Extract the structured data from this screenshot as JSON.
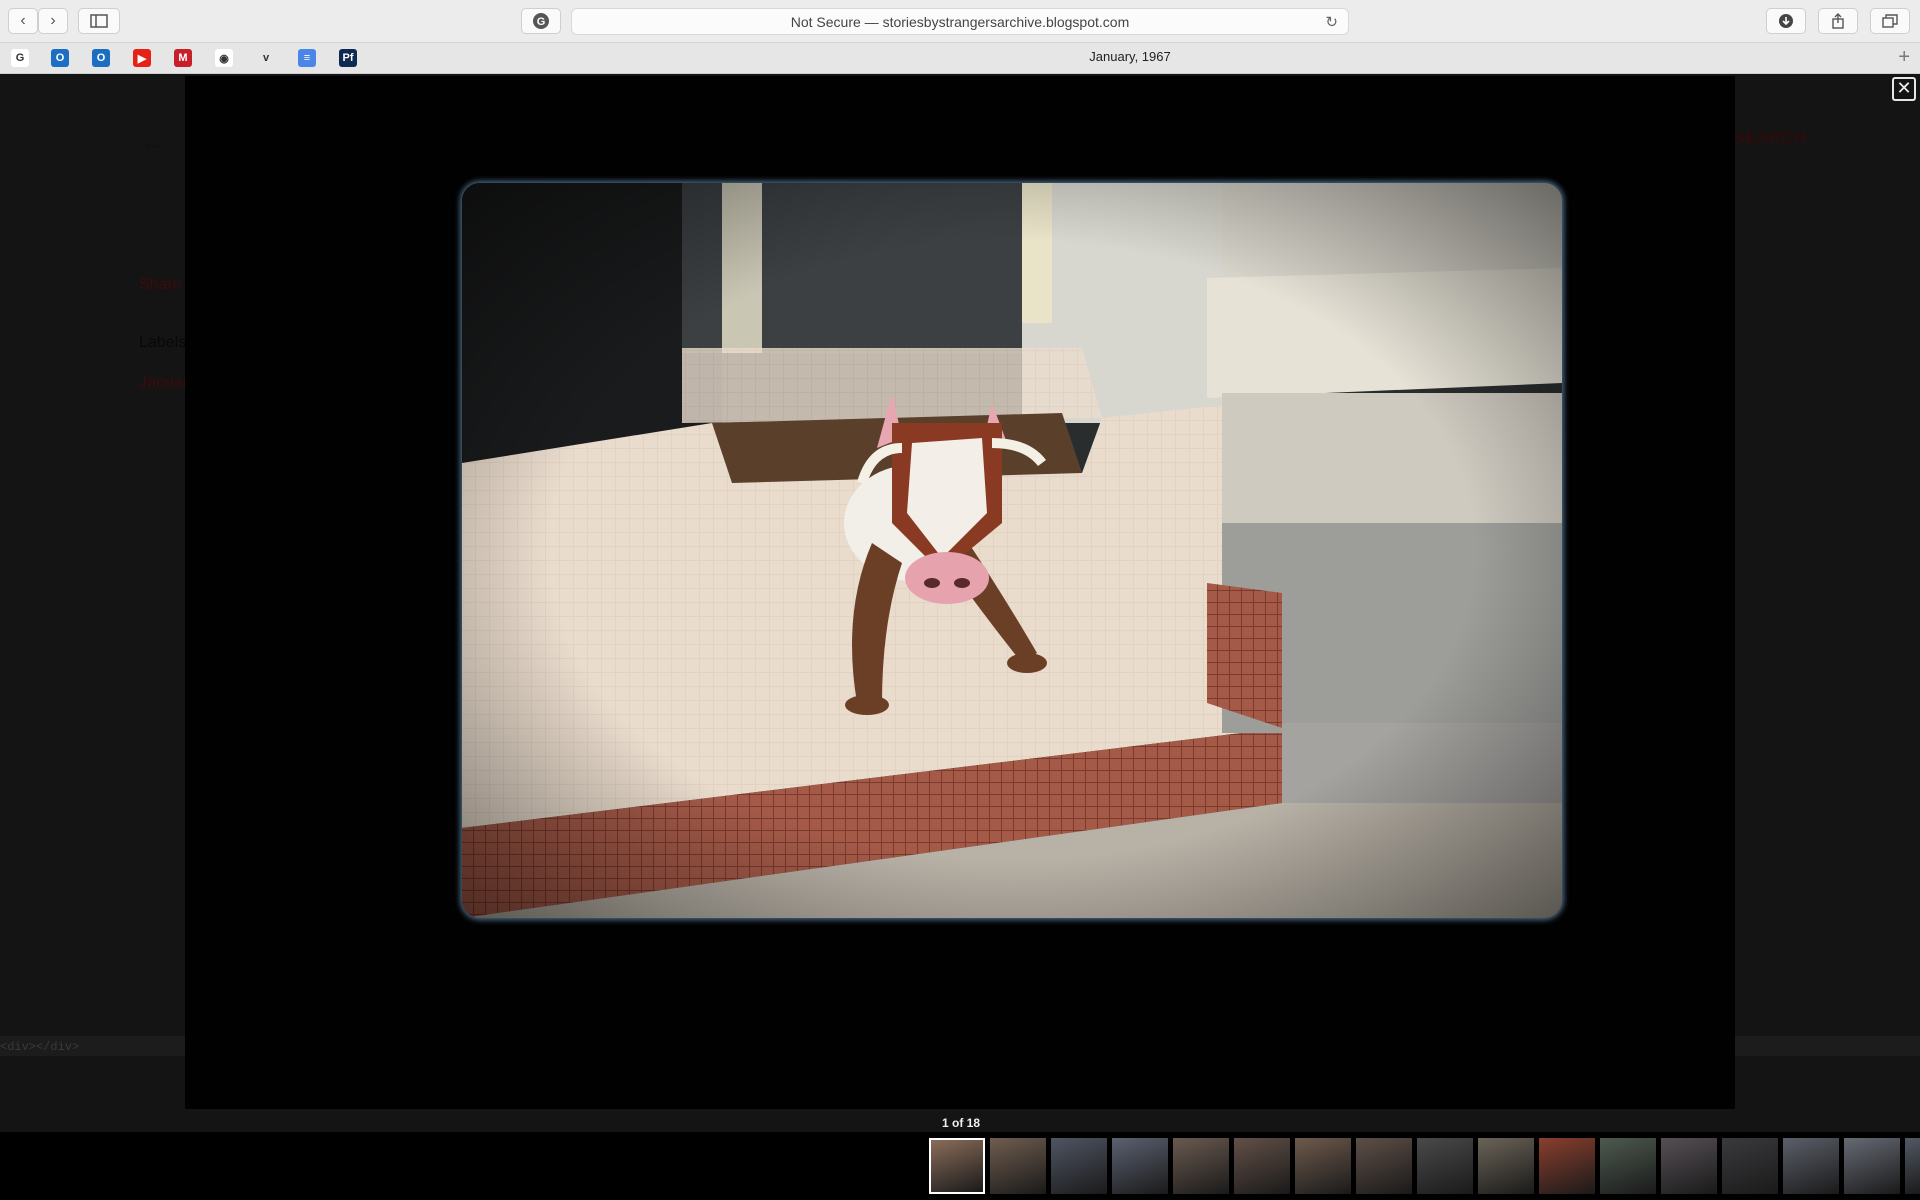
{
  "browser": {
    "address_text": "Not Secure — storiesbystrangersarchive.blogspot.com",
    "tab_title": "January, 1967",
    "bookmarks": [
      {
        "icon": "google-icon",
        "letter": "G",
        "color": "#ffffff"
      },
      {
        "icon": "outlook-icon",
        "letter": "O",
        "color": "#1b6ec2"
      },
      {
        "icon": "outlook-icon",
        "letter": "O",
        "color": "#1b6ec2"
      },
      {
        "icon": "youtube-icon",
        "letter": "▶",
        "color": "#e62117"
      },
      {
        "icon": "gmail-icon",
        "letter": "M",
        "color": "#c7202b"
      },
      {
        "icon": "eye-icon",
        "letter": "◉",
        "color": "#ffffff"
      },
      {
        "icon": "vimeo-icon",
        "letter": "v",
        "color": "#e6e6e6"
      },
      {
        "icon": "docs-icon",
        "letter": "≡",
        "color": "#4a86e8"
      },
      {
        "icon": "portfolio-icon",
        "letter": "Pf",
        "color": "#0f2a52"
      }
    ]
  },
  "page": {
    "search_label": "SEARCH",
    "share_label": "Share",
    "labels_heading": "Labels",
    "label_january": "January",
    "code_text": "<div></div>"
  },
  "lightbox": {
    "counter": "1 of 18",
    "thumbnails": [
      {
        "color": "#8a6d5a",
        "active": true
      },
      {
        "color": "#6f5d4f",
        "active": false
      },
      {
        "color": "#4f5563",
        "active": false
      },
      {
        "color": "#5b6170",
        "active": false
      },
      {
        "color": "#6a5a50",
        "active": false
      },
      {
        "color": "#625047",
        "active": false
      },
      {
        "color": "#6e5a4c",
        "active": false
      },
      {
        "color": "#5e4f47",
        "active": false
      },
      {
        "color": "#4a4a4a",
        "active": false
      },
      {
        "color": "#6b6357",
        "active": false
      },
      {
        "color": "#8a3f2e",
        "active": false
      },
      {
        "color": "#4d5a4f",
        "active": false
      },
      {
        "color": "#565055",
        "active": false
      },
      {
        "color": "#3a3a3e",
        "active": false
      },
      {
        "color": "#5c5f6a",
        "active": false
      },
      {
        "color": "#666a74",
        "active": false
      },
      {
        "color": "#525a66",
        "active": false
      },
      {
        "color": "#4e4e4e",
        "active": false
      }
    ]
  },
  "colors": {
    "accent_red": "#3d0b0b",
    "lightbox_bg": "#010101"
  }
}
